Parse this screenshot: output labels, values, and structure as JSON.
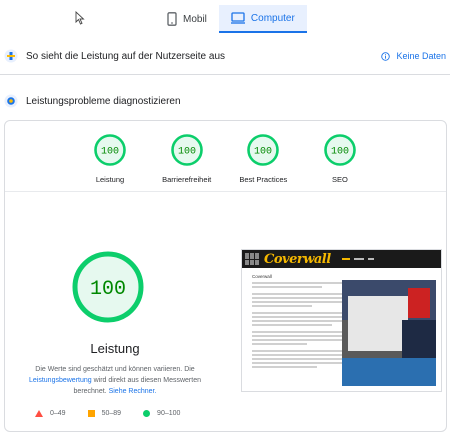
{
  "tabs": [
    {
      "label": "Mobil",
      "icon": "smartphone-icon",
      "active": false
    },
    {
      "label": "Computer",
      "icon": "desktop-icon",
      "active": true
    }
  ],
  "field_data": {
    "title": "So sieht die Leistung auf der Nutzerseite aus",
    "no_data_label": "Keine Daten"
  },
  "diagnostics": {
    "title": "Leistungsprobleme diagnostizieren"
  },
  "categories": [
    {
      "label": "Leistung",
      "score": "100"
    },
    {
      "label": "Barrierefreiheit",
      "score": "100"
    },
    {
      "label": "Best Practices",
      "score": "100"
    },
    {
      "label": "SEO",
      "score": "100"
    }
  ],
  "performance": {
    "score": "100",
    "title": "Leistung",
    "desc_part1": "Die Werte sind geschätzt und können variieren. Die",
    "desc_link": "Leistungsbewertung",
    "desc_part2": "wird direkt aus diesen Messwerten berechnet.",
    "desc_link2": "Siehe Rechner."
  },
  "legend": [
    {
      "range": "0–49",
      "shape": "triangle",
      "color": "#ff4e42"
    },
    {
      "range": "50–89",
      "shape": "square",
      "color": "#ffa400"
    },
    {
      "range": "90–100",
      "shape": "circle",
      "color": "#0cce6b"
    }
  ],
  "screenshot": {
    "brand": "Coverwall",
    "subtitle": "Coverwall"
  },
  "colors": {
    "accent": "#1a73e8",
    "pass": "#0cce6b",
    "pass_text": "#008800"
  }
}
